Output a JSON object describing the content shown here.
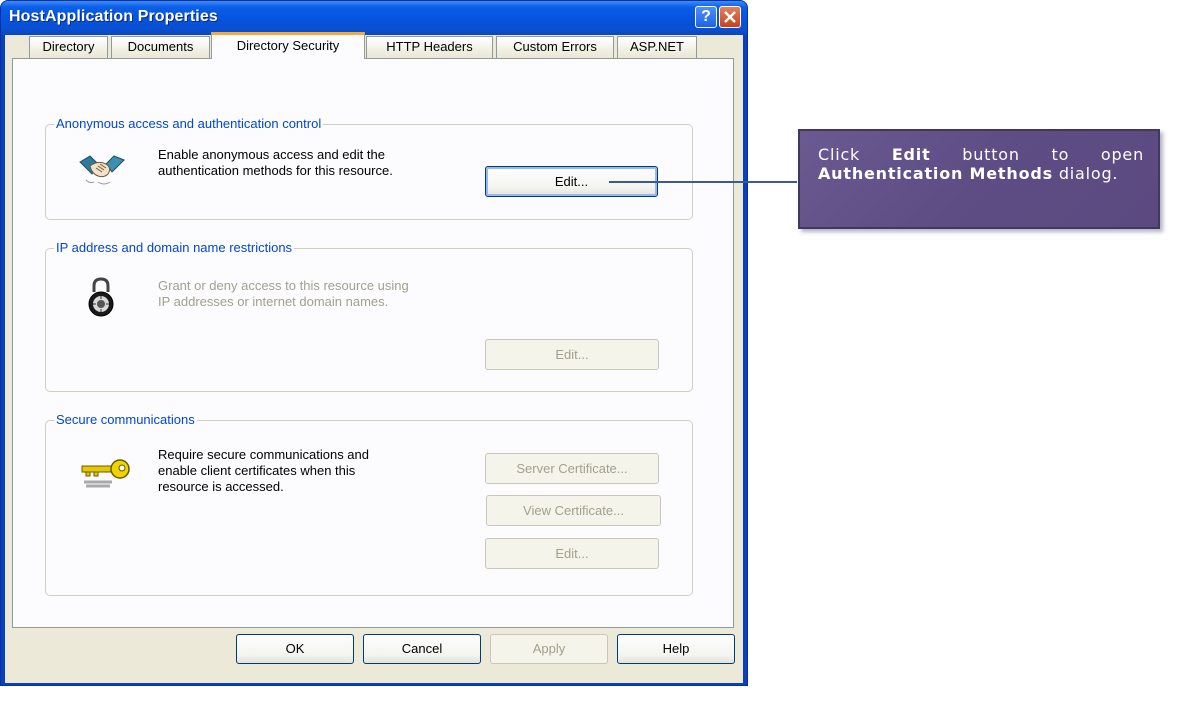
{
  "window": {
    "title": "HostApplication Properties",
    "help_button": "?",
    "close_button": "×"
  },
  "tabs": [
    {
      "label": "Directory",
      "active": false
    },
    {
      "label": "Documents",
      "active": false
    },
    {
      "label": "Directory Security",
      "active": true
    },
    {
      "label": "HTTP Headers",
      "active": false
    },
    {
      "label": "Custom Errors",
      "active": false
    },
    {
      "label": "ASP.NET",
      "active": false
    }
  ],
  "groups": {
    "anonymous": {
      "title": "Anonymous access and authentication control",
      "description_line1": "Enable anonymous access and edit the",
      "description_line2": "authentication methods for this resource.",
      "icon": "handshake-icon",
      "edit_label": "Edit..."
    },
    "ip": {
      "title": "IP address and domain name restrictions",
      "description_line1": "Grant or deny access to this resource using",
      "description_line2": "IP addresses or internet domain names.",
      "icon": "padlock-icon",
      "edit_label": "Edit..."
    },
    "secure": {
      "title": "Secure communications",
      "description_line1": "Require secure communications and",
      "description_line2": "enable client certificates when this",
      "description_line3": "resource is accessed.",
      "icon": "key-icon",
      "server_cert_label": "Server Certificate...",
      "view_cert_label": "View Certificate...",
      "edit_label": "Edit..."
    }
  },
  "footer": {
    "ok": "OK",
    "cancel": "Cancel",
    "apply": "Apply",
    "help": "Help"
  },
  "callout": {
    "part1": "Click",
    "bold1": "Edit",
    "part2": "button to open",
    "bold2": "Authentication Methods",
    "part3": "dialog."
  },
  "colors": {
    "titlebar": "#0653de",
    "group_label": "#0046d5",
    "active_tab_accent": "#f5a93a",
    "callout_bg": "#5d4d84",
    "connector": "#3c5a8a"
  }
}
